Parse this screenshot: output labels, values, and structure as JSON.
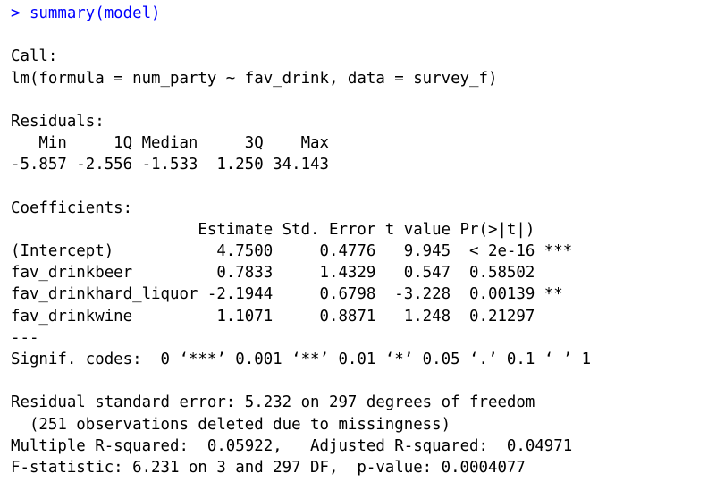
{
  "console": {
    "command_line": "> summary(model)",
    "call_header": "Call:",
    "call_text": "lm(formula = num_party ~ fav_drink, data = survey_f)",
    "residuals_header": "Residuals:",
    "residuals_labels_row": "   Min     1Q Median     3Q    Max ",
    "residuals_values_row": "-5.857 -2.556 -1.533  1.250 34.143 ",
    "coefficients_header": "Coefficients:",
    "coef_table_header": "                    Estimate Std. Error t value Pr(>|t|)    ",
    "coef_rows": [
      "(Intercept)           4.7500     0.4776   9.945  < 2e-16 ***",
      "fav_drinkbeer         0.7833     1.4329   0.547  0.58502    ",
      "fav_drinkhard_liquor -2.1944     0.6798  -3.228  0.00139 ** ",
      "fav_drinkwine         1.1071     0.8871   1.248  0.21297    "
    ],
    "separator": "---",
    "signif_codes": "Signif. codes:  0 ‘***’ 0.001 ‘**’ 0.01 ‘*’ 0.05 ‘.’ 0.1 ‘ ’ 1",
    "residual_se": "Residual standard error: 5.232 on 297 degrees of freedom",
    "deleted_obs": "  (251 observations deleted due to missingness)",
    "r_squared": "Multiple R-squared:  0.05922,\tAdjusted R-squared:  0.04971 ",
    "f_statistic": "F-statistic: 6.231 on 3 and 297 DF,  p-value: 0.0004077"
  },
  "colors": {
    "prompt": "#0000ff",
    "output": "#000000",
    "background": "#ffffff"
  }
}
